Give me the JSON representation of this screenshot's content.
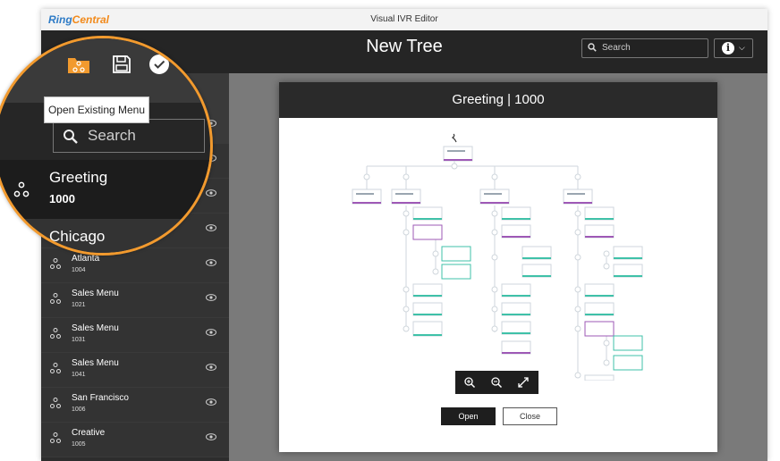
{
  "window": {
    "logo_ring": "Ring",
    "logo_central": "Central",
    "title": "Visual IVR Editor"
  },
  "header": {
    "tree_title": "New Tree",
    "search_placeholder": "Search"
  },
  "toolbar": {
    "tooltip": "Open Existing Menu",
    "search_placeholder": "Search"
  },
  "sidebar": {
    "items": [
      {
        "name": "Greeting",
        "id": "1000",
        "selected": true
      },
      {
        "name": "Chicago",
        "id": ""
      },
      {
        "name": "Atlanta",
        "id": "1004"
      },
      {
        "name": "Sales Menu",
        "id": "1021"
      },
      {
        "name": "Sales Menu",
        "id": "1031"
      },
      {
        "name": "Sales Menu",
        "id": "1041"
      },
      {
        "name": "San Francisco",
        "id": "1006"
      },
      {
        "name": "Creative",
        "id": "1005"
      }
    ]
  },
  "dialog": {
    "title": "Greeting | 1000",
    "open_label": "Open",
    "close_label": "Close"
  },
  "colors": {
    "accent_orange": "#f29a2e",
    "purple": "#9e59b6",
    "teal": "#3fc1a8",
    "header_dark": "#252525"
  }
}
